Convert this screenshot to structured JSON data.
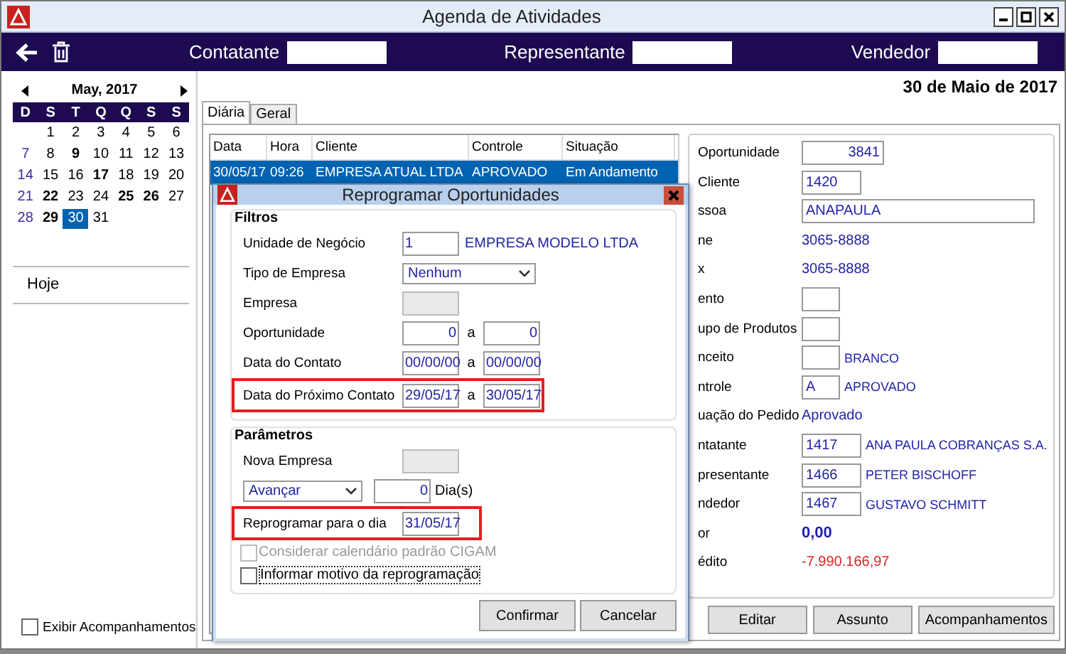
{
  "window": {
    "title": "Agenda de Atividades"
  },
  "toolbar": {
    "filters": [
      {
        "label": "Contatante"
      },
      {
        "label": "Representante"
      },
      {
        "label": "Vendedor"
      }
    ]
  },
  "calendar": {
    "month": "May, 2017",
    "weekdays": [
      "D",
      "S",
      "T",
      "Q",
      "Q",
      "S",
      "S"
    ],
    "weeks": [
      [
        {
          "day": "1",
          "bold": false,
          "selected": false
        },
        {
          "day": "2",
          "bold": false,
          "selected": false
        },
        {
          "day": "3",
          "bold": false,
          "selected": false
        },
        {
          "day": "4",
          "bold": false,
          "selected": false
        },
        {
          "day": "5",
          "bold": false,
          "selected": false
        },
        {
          "day": "6",
          "bold": false,
          "selected": false
        }
      ],
      [
        {
          "day": "7",
          "bold": false,
          "selected": false
        },
        {
          "day": "8",
          "bold": false,
          "selected": false
        },
        {
          "day": "9",
          "bold": true,
          "selected": false
        },
        {
          "day": "10",
          "bold": false,
          "selected": false
        },
        {
          "day": "11",
          "bold": false,
          "selected": false
        },
        {
          "day": "12",
          "bold": false,
          "selected": false
        },
        {
          "day": "13",
          "bold": false,
          "selected": false
        }
      ],
      [
        {
          "day": "14",
          "bold": false,
          "selected": false
        },
        {
          "day": "15",
          "bold": false,
          "selected": false
        },
        {
          "day": "16",
          "bold": false,
          "selected": false
        },
        {
          "day": "17",
          "bold": true,
          "selected": false
        },
        {
          "day": "18",
          "bold": false,
          "selected": false
        },
        {
          "day": "19",
          "bold": false,
          "selected": false
        },
        {
          "day": "20",
          "bold": false,
          "selected": false
        }
      ],
      [
        {
          "day": "21",
          "bold": false,
          "selected": false
        },
        {
          "day": "22",
          "bold": true,
          "selected": false
        },
        {
          "day": "23",
          "bold": false,
          "selected": false
        },
        {
          "day": "24",
          "bold": false,
          "selected": false
        },
        {
          "day": "25",
          "bold": true,
          "selected": false
        },
        {
          "day": "26",
          "bold": true,
          "selected": false
        },
        {
          "day": "27",
          "bold": false,
          "selected": false
        }
      ],
      [
        {
          "day": "28",
          "bold": false,
          "selected": false
        },
        {
          "day": "29",
          "bold": true,
          "selected": false
        },
        {
          "day": "30",
          "bold": false,
          "selected": true
        },
        {
          "day": "31",
          "bold": false,
          "selected": false
        }
      ]
    ]
  },
  "sidebar": {
    "today": "Hoje",
    "show_followups": {
      "label": "Exibir Acompanhamentos",
      "checked": false
    }
  },
  "date_heading": "30 de Maio de 2017",
  "tabs": [
    {
      "label": "Diária",
      "selected": true
    },
    {
      "label": "Geral",
      "selected": false
    }
  ],
  "table": {
    "columns": [
      "Data",
      "Hora",
      "Cliente",
      "Controle",
      "Situação"
    ],
    "rows": [
      {
        "cells": [
          "30/05/17",
          "09:26",
          "EMPRESA ATUAL LTDA",
          "APROVADO",
          "Em Andamento"
        ],
        "selected": true
      }
    ]
  },
  "details": {
    "fields": [
      {
        "label": "Oportunidade",
        "kind": "number",
        "value": "3841"
      },
      {
        "label": "Cliente",
        "kind": "code",
        "value": "1420"
      },
      {
        "label": "ssoa",
        "kind": "wide",
        "value": "ANAPAULA"
      },
      {
        "label": "ne",
        "kind": "text",
        "value": "3065-8888"
      },
      {
        "label": "x",
        "kind": "text",
        "value": "3065-8888"
      },
      {
        "label": "ento",
        "kind": "small"
      },
      {
        "label": "upo de Produtos",
        "kind": "small"
      },
      {
        "label": "nceito",
        "kind": "small",
        "extra": "BRANCO"
      },
      {
        "label": "ntrole",
        "kind": "small",
        "value": "A",
        "extra": "APROVADO"
      },
      {
        "label": "uação do Pedido",
        "kind": "text",
        "value": "Aprovado"
      },
      {
        "label": "ntatante",
        "kind": "code",
        "value": "1417",
        "extra": "ANA PAULA COBRANÇAS S.A."
      },
      {
        "label": "presentante",
        "kind": "code",
        "value": "1466",
        "extra": "PETER BISCHOFF"
      },
      {
        "label": "ndedor",
        "kind": "code",
        "value": "1467",
        "extra": "GUSTAVO SCHMITT"
      },
      {
        "label": "or",
        "kind": "strong",
        "value": "0,00"
      },
      {
        "label": "édito",
        "kind": "negative",
        "value": "-7.990.166,97"
      }
    ]
  },
  "buttons": [
    "Editar",
    "Assunto",
    "Acompanhamentos"
  ],
  "dialog": {
    "title": "Reprogramar Oportunidades",
    "filters": {
      "title": "Filtros",
      "rows": [
        {
          "kind": "code",
          "label": "Unidade de Negócio",
          "value": "1",
          "extra": "EMPRESA MODELO LTDA",
          "highlighted": false
        },
        {
          "kind": "select",
          "label": "Tipo de Empresa",
          "value": "Nenhum",
          "highlighted": false
        },
        {
          "kind": "empty",
          "label": "Empresa",
          "highlighted": false
        },
        {
          "kind": "numrange",
          "label": "Oportunidade",
          "from": "0",
          "sep": "a",
          "to": "0",
          "highlighted": false
        },
        {
          "kind": "range",
          "label": "Data do Contato",
          "from": "00/00/00",
          "sep": "a",
          "to": "00/00/00",
          "highlighted": false
        },
        {
          "kind": "range",
          "label": "Data do Próximo Contato",
          "from": "29/05/17",
          "sep": "a",
          "to": "30/05/17",
          "highlighted": true
        }
      ]
    },
    "params": {
      "title": "Parâmetros",
      "new_company": {
        "label": "Nova Empresa"
      },
      "direction": {
        "value": "Avançar"
      },
      "days": {
        "value": "0",
        "unit": "Dia(s)"
      },
      "reschedule": {
        "label": "Reprogramar para o dia",
        "value": "31/05/17",
        "highlighted": true
      },
      "checks": [
        {
          "label": "Considerar calendário padrão CIGAM",
          "checked": false,
          "disabled": true
        },
        {
          "label": "Informar motivo da reprogramação",
          "checked": false,
          "disabled": false
        }
      ]
    },
    "buttons": [
      "Confirmar",
      "Cancelar"
    ]
  }
}
